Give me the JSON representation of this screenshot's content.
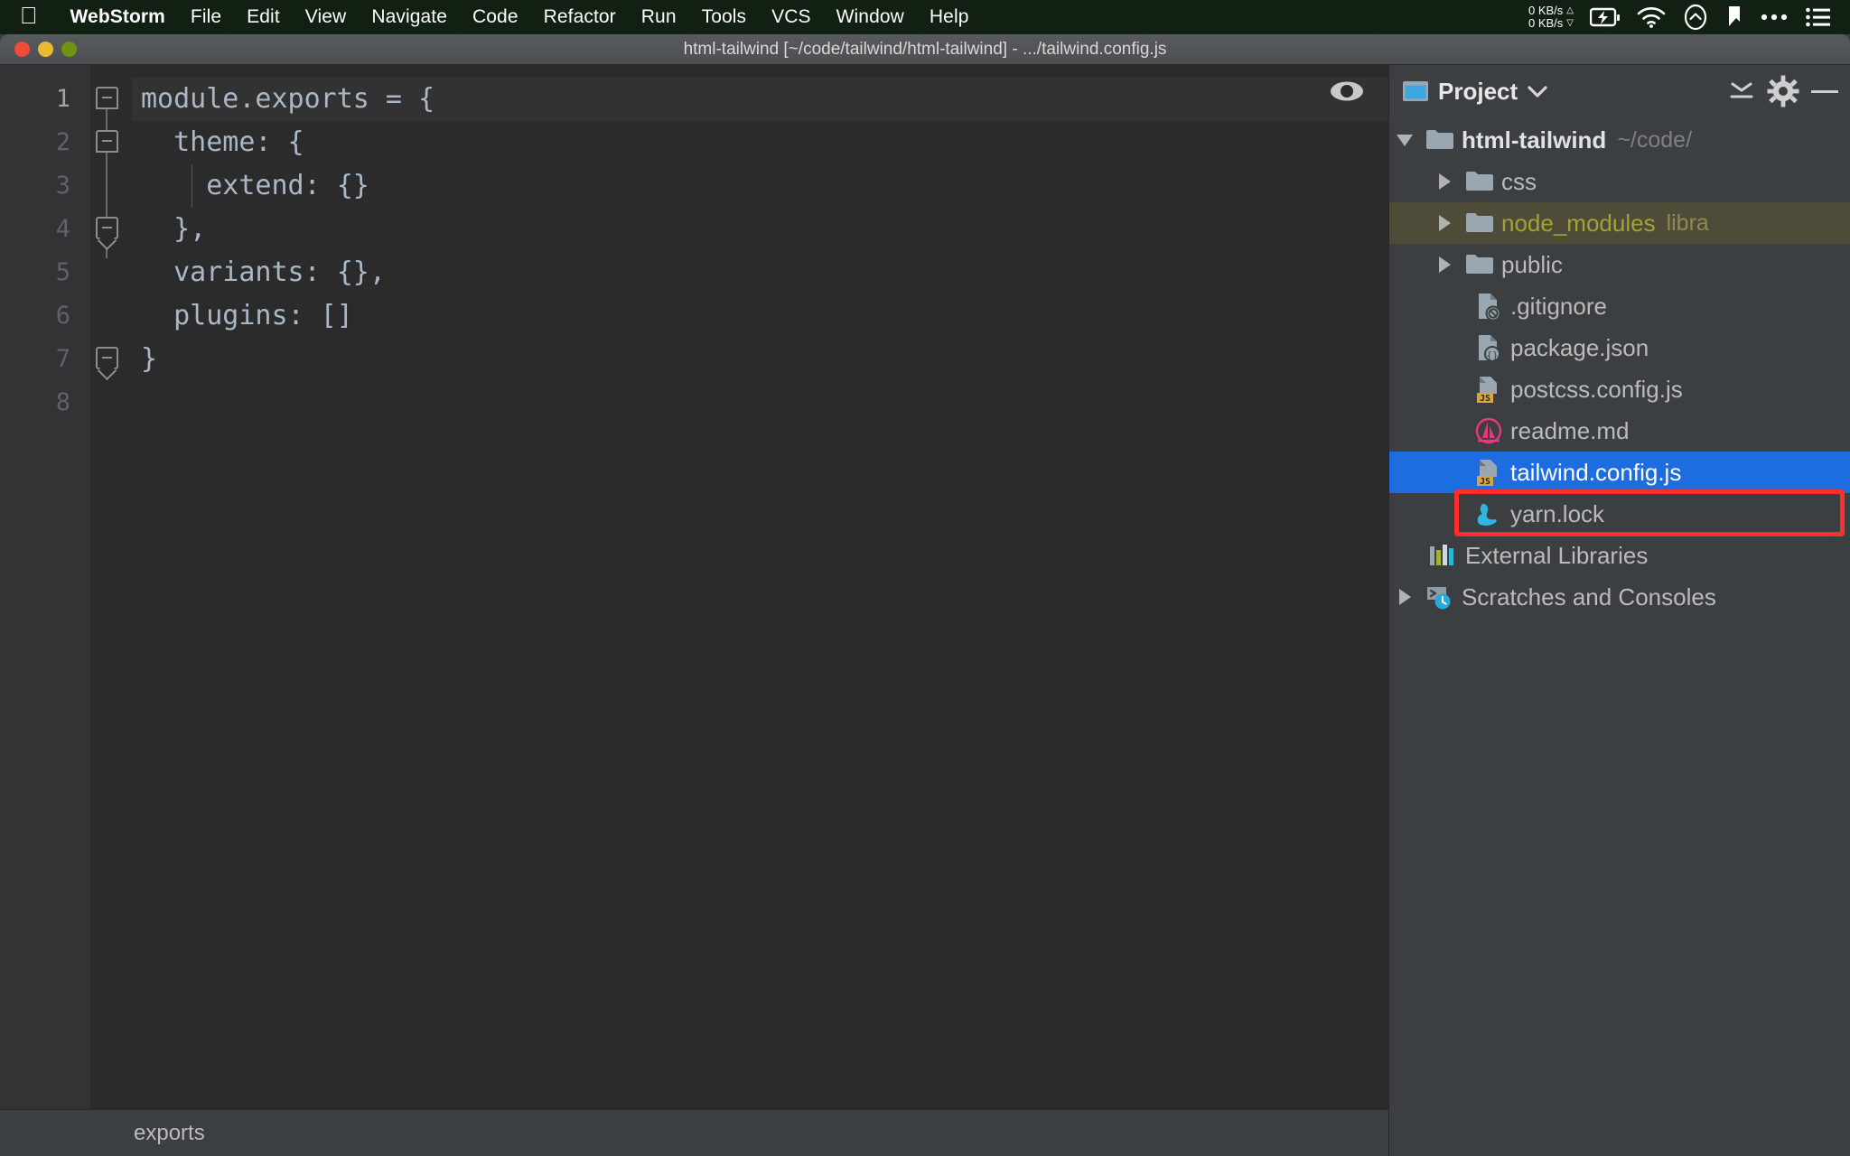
{
  "menubar": {
    "apple_icon": "apple-logo",
    "items": [
      {
        "label": "WebStorm",
        "bold": true
      },
      {
        "label": "File",
        "bold": false
      },
      {
        "label": "Edit",
        "bold": false
      },
      {
        "label": "View",
        "bold": false
      },
      {
        "label": "Navigate",
        "bold": false
      },
      {
        "label": "Code",
        "bold": false
      },
      {
        "label": "Refactor",
        "bold": false
      },
      {
        "label": "Run",
        "bold": false
      },
      {
        "label": "Tools",
        "bold": false
      },
      {
        "label": "VCS",
        "bold": false
      },
      {
        "label": "Window",
        "bold": false
      },
      {
        "label": "Help",
        "bold": false
      }
    ],
    "status": {
      "net_up": "0 KB/s",
      "net_down": "0 KB/s",
      "up_arrow": "△",
      "down_arrow": "▽",
      "icons": [
        "battery-charging-icon",
        "wifi-icon",
        "cloud-arrow-icon",
        "bookmark-icon",
        "ellipsis-icon",
        "control-center-icon"
      ]
    }
  },
  "window": {
    "title": "html-tailwind [~/code/tailwind/html-tailwind] - .../tailwind.config.js",
    "traffic_lights": [
      "close-button",
      "minimize-button",
      "zoom-button"
    ]
  },
  "editor": {
    "line_numbers": [
      "1",
      "2",
      "3",
      "4",
      "5",
      "6",
      "7",
      "8"
    ],
    "current_line": 1,
    "code_lines": [
      {
        "n": 1,
        "text": "module.exports = {"
      },
      {
        "n": 2,
        "text": "  theme: {"
      },
      {
        "n": 3,
        "text": "    extend: {}"
      },
      {
        "n": 4,
        "text": "  },",
        "comma": true
      },
      {
        "n": 5,
        "text": "  variants: {},",
        "comma": true
      },
      {
        "n": 6,
        "text": "  plugins: []"
      },
      {
        "n": 7,
        "text": "}"
      },
      {
        "n": 8,
        "text": ""
      }
    ],
    "eye_icon": "preview-eye-icon",
    "breadcrumb": "exports"
  },
  "project_panel": {
    "title": "Project",
    "title_icon": "project-view-icon",
    "dropdown_icon": "chevron-down-icon",
    "collapse_icon": "collapse-all-icon",
    "settings_icon": "gear-icon",
    "hide_icon": "minimize-panel-icon",
    "tree": [
      {
        "label": "html-tailwind",
        "sub": "~/code/",
        "depth": 0,
        "arrow": "down",
        "icon": "folder-icon",
        "type": "project-root"
      },
      {
        "label": "css",
        "sub": "",
        "depth": 1,
        "arrow": "right",
        "icon": "folder-icon",
        "type": "folder"
      },
      {
        "label": "node_modules",
        "sub": "libra",
        "depth": 1,
        "arrow": "right",
        "icon": "folder-icon",
        "type": "library-folder"
      },
      {
        "label": "public",
        "sub": "",
        "depth": 1,
        "arrow": "right",
        "icon": "folder-icon",
        "type": "folder"
      },
      {
        "label": ".gitignore",
        "sub": "",
        "depth": 1,
        "arrow": "none",
        "icon": "gitignore-file-icon",
        "type": "file"
      },
      {
        "label": "package.json",
        "sub": "",
        "depth": 1,
        "arrow": "none",
        "icon": "json-file-icon",
        "type": "file"
      },
      {
        "label": "postcss.config.js",
        "sub": "",
        "depth": 1,
        "arrow": "none",
        "icon": "js-file-icon",
        "type": "file"
      },
      {
        "label": "readme.md",
        "sub": "",
        "depth": 1,
        "arrow": "none",
        "icon": "markdown-file-icon",
        "type": "file"
      },
      {
        "label": "tailwind.config.js",
        "sub": "",
        "depth": 1,
        "arrow": "none",
        "icon": "js-file-icon",
        "type": "file",
        "selected": true,
        "annotated": true
      },
      {
        "label": "yarn.lock",
        "sub": "",
        "depth": 1,
        "arrow": "none",
        "icon": "yarn-file-icon",
        "type": "file"
      },
      {
        "label": "External Libraries",
        "sub": "",
        "depth": 0,
        "arrow": "none",
        "icon": "external-libraries-icon",
        "type": "node"
      },
      {
        "label": "Scratches and Consoles",
        "sub": "",
        "depth": 0,
        "arrow": "right",
        "icon": "scratches-icon",
        "type": "node"
      }
    ]
  },
  "colors": {
    "menubar_bg": "#122013",
    "editor_bg": "#2b2b2b",
    "panel_bg": "#3c3f41",
    "selection_blue": "#1d6ce0",
    "annotation_red": "#ff2d2d",
    "code_text": "#a9b7c6",
    "comma_orange": "#cc7832",
    "library_yellow": "#a3a334"
  }
}
